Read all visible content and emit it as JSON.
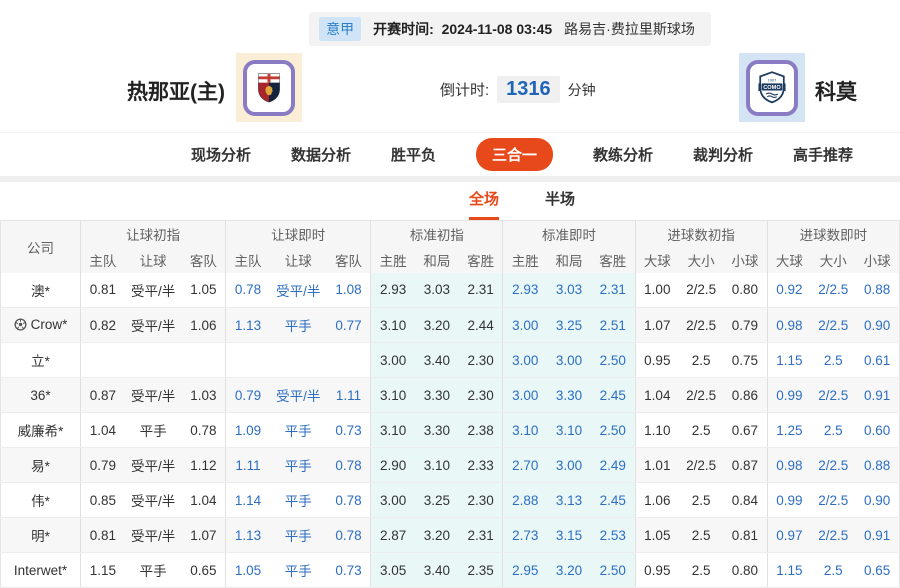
{
  "header": {
    "league": "意甲",
    "kickoff_label": "开赛时间:",
    "kickoff_time": "2024-11-08 03:45",
    "venue": "路易吉·费拉里斯球场"
  },
  "match": {
    "home_name": "热那亚(主)",
    "home_logo_icon": "genoa-crest-icon",
    "away_name": "科莫",
    "away_logo_icon": "como-crest-icon",
    "countdown_label": "倒计时:",
    "countdown_value": "1316",
    "countdown_unit": "分钟"
  },
  "nav": {
    "tabs": [
      {
        "label": "现场分析",
        "active": false
      },
      {
        "label": "数据分析",
        "active": false
      },
      {
        "label": "胜平负",
        "active": false
      },
      {
        "label": "三合一",
        "active": true
      },
      {
        "label": "教练分析",
        "active": false
      },
      {
        "label": "裁判分析",
        "active": false
      },
      {
        "label": "高手推荐",
        "active": false
      }
    ]
  },
  "subtabs": [
    {
      "label": "全场",
      "active": true
    },
    {
      "label": "半场",
      "active": false
    }
  ],
  "table": {
    "company_header": "公司",
    "groups": [
      {
        "label": "让球初指",
        "cols": [
          "主队",
          "让球",
          "客队"
        ],
        "live": false,
        "cyan": false
      },
      {
        "label": "让球即时",
        "cols": [
          "主队",
          "让球",
          "客队"
        ],
        "live": true,
        "cyan": false
      },
      {
        "label": "标准初指",
        "cols": [
          "主胜",
          "和局",
          "客胜"
        ],
        "live": false,
        "cyan": true
      },
      {
        "label": "标准即时",
        "cols": [
          "主胜",
          "和局",
          "客胜"
        ],
        "live": true,
        "cyan": true
      },
      {
        "label": "进球数初指",
        "cols": [
          "大球",
          "大小",
          "小球"
        ],
        "live": false,
        "cyan": false
      },
      {
        "label": "进球数即时",
        "cols": [
          "大球",
          "大小",
          "小球"
        ],
        "live": true,
        "cyan": false
      }
    ],
    "rows": [
      {
        "company": "澳*",
        "icon": null,
        "values": [
          [
            "0.81",
            "受平/半",
            "1.05"
          ],
          [
            "0.78",
            "受平/半",
            "1.08"
          ],
          [
            "2.93",
            "3.03",
            "2.31"
          ],
          [
            "2.93",
            "3.03",
            "2.31"
          ],
          [
            "1.00",
            "2/2.5",
            "0.80"
          ],
          [
            "0.92",
            "2/2.5",
            "0.88"
          ]
        ]
      },
      {
        "company": "Crow*",
        "icon": "football-icon",
        "values": [
          [
            "0.82",
            "受平/半",
            "1.06"
          ],
          [
            "1.13",
            "平手",
            "0.77"
          ],
          [
            "3.10",
            "3.20",
            "2.44"
          ],
          [
            "3.00",
            "3.25",
            "2.51"
          ],
          [
            "1.07",
            "2/2.5",
            "0.79"
          ],
          [
            "0.98",
            "2/2.5",
            "0.90"
          ]
        ]
      },
      {
        "company": "立*",
        "icon": null,
        "values": [
          [
            "",
            "",
            ""
          ],
          [
            "",
            "",
            ""
          ],
          [
            "3.00",
            "3.40",
            "2.30"
          ],
          [
            "3.00",
            "3.00",
            "2.50"
          ],
          [
            "0.95",
            "2.5",
            "0.75"
          ],
          [
            "1.15",
            "2.5",
            "0.61"
          ]
        ]
      },
      {
        "company": "36*",
        "icon": null,
        "values": [
          [
            "0.87",
            "受平/半",
            "1.03"
          ],
          [
            "0.79",
            "受平/半",
            "1.11"
          ],
          [
            "3.10",
            "3.30",
            "2.30"
          ],
          [
            "3.00",
            "3.30",
            "2.45"
          ],
          [
            "1.04",
            "2/2.5",
            "0.86"
          ],
          [
            "0.99",
            "2/2.5",
            "0.91"
          ]
        ]
      },
      {
        "company": "威廉希*",
        "icon": null,
        "values": [
          [
            "1.04",
            "平手",
            "0.78"
          ],
          [
            "1.09",
            "平手",
            "0.73"
          ],
          [
            "3.10",
            "3.30",
            "2.38"
          ],
          [
            "3.10",
            "3.10",
            "2.50"
          ],
          [
            "1.10",
            "2.5",
            "0.67"
          ],
          [
            "1.25",
            "2.5",
            "0.60"
          ]
        ]
      },
      {
        "company": "易*",
        "icon": null,
        "values": [
          [
            "0.79",
            "受平/半",
            "1.12"
          ],
          [
            "1.11",
            "平手",
            "0.78"
          ],
          [
            "2.90",
            "3.10",
            "2.33"
          ],
          [
            "2.70",
            "3.00",
            "2.49"
          ],
          [
            "1.01",
            "2/2.5",
            "0.87"
          ],
          [
            "0.98",
            "2/2.5",
            "0.88"
          ]
        ]
      },
      {
        "company": "伟*",
        "icon": null,
        "values": [
          [
            "0.85",
            "受平/半",
            "1.04"
          ],
          [
            "1.14",
            "平手",
            "0.78"
          ],
          [
            "3.00",
            "3.25",
            "2.30"
          ],
          [
            "2.88",
            "3.13",
            "2.45"
          ],
          [
            "1.06",
            "2.5",
            "0.84"
          ],
          [
            "0.99",
            "2/2.5",
            "0.90"
          ]
        ]
      },
      {
        "company": "明*",
        "icon": null,
        "values": [
          [
            "0.81",
            "受平/半",
            "1.07"
          ],
          [
            "1.13",
            "平手",
            "0.78"
          ],
          [
            "2.87",
            "3.20",
            "2.31"
          ],
          [
            "2.73",
            "3.15",
            "2.53"
          ],
          [
            "1.05",
            "2.5",
            "0.81"
          ],
          [
            "0.97",
            "2/2.5",
            "0.91"
          ]
        ]
      },
      {
        "company": "Interwet*",
        "icon": null,
        "values": [
          [
            "1.15",
            "平手",
            "0.65"
          ],
          [
            "1.05",
            "平手",
            "0.73"
          ],
          [
            "3.05",
            "3.40",
            "2.35"
          ],
          [
            "2.95",
            "3.20",
            "2.50"
          ],
          [
            "0.95",
            "2.5",
            "0.80"
          ],
          [
            "1.15",
            "2.5",
            "0.65"
          ]
        ]
      }
    ]
  },
  "colors": {
    "accent": "#e8491a",
    "live_value": "#2d6ec3",
    "league_badge_bg": "#cfe5f7",
    "league_badge_text": "#2e7fc9",
    "standard_col_bg": "#e9f8f7",
    "countdown_value": "#1f65b8"
  }
}
